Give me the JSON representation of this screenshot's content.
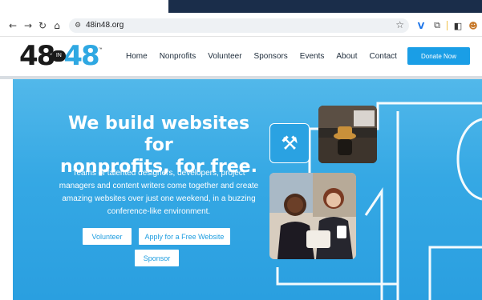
{
  "browser": {
    "url": "48in48.org",
    "back_icon": "arrow-left-icon",
    "forward_icon": "arrow-right-icon",
    "reload_icon": "reload-icon",
    "home_icon": "home-icon",
    "site_info_icon": "site-settings-icon",
    "bookmark_icon": "star-icon"
  },
  "site": {
    "logo": {
      "left": "48",
      "middle": "IN",
      "right": "48",
      "tm": "™"
    },
    "nav": [
      "Home",
      "Nonprofits",
      "Volunteer",
      "Sponsors",
      "Events",
      "About",
      "Contact"
    ],
    "donate_label": "Donate Now"
  },
  "hero": {
    "title_line1": "We build websites for",
    "title_line2": "nonprofits, for free.",
    "description": "Teams of talented designers, developers, project managers and content writers come together and create amazing websites over just one weekend, in a buzzing conference-like environment.",
    "buttons": {
      "volunteer": "Volunteer",
      "apply": "Apply for a Free Website",
      "sponsor": "Sponsor"
    },
    "tile_icon": "hammer-icon"
  },
  "colors": {
    "brand_blue": "#2fa8e2",
    "button_blue": "#1a9ee6",
    "hero_blue": "#35a8e4"
  }
}
